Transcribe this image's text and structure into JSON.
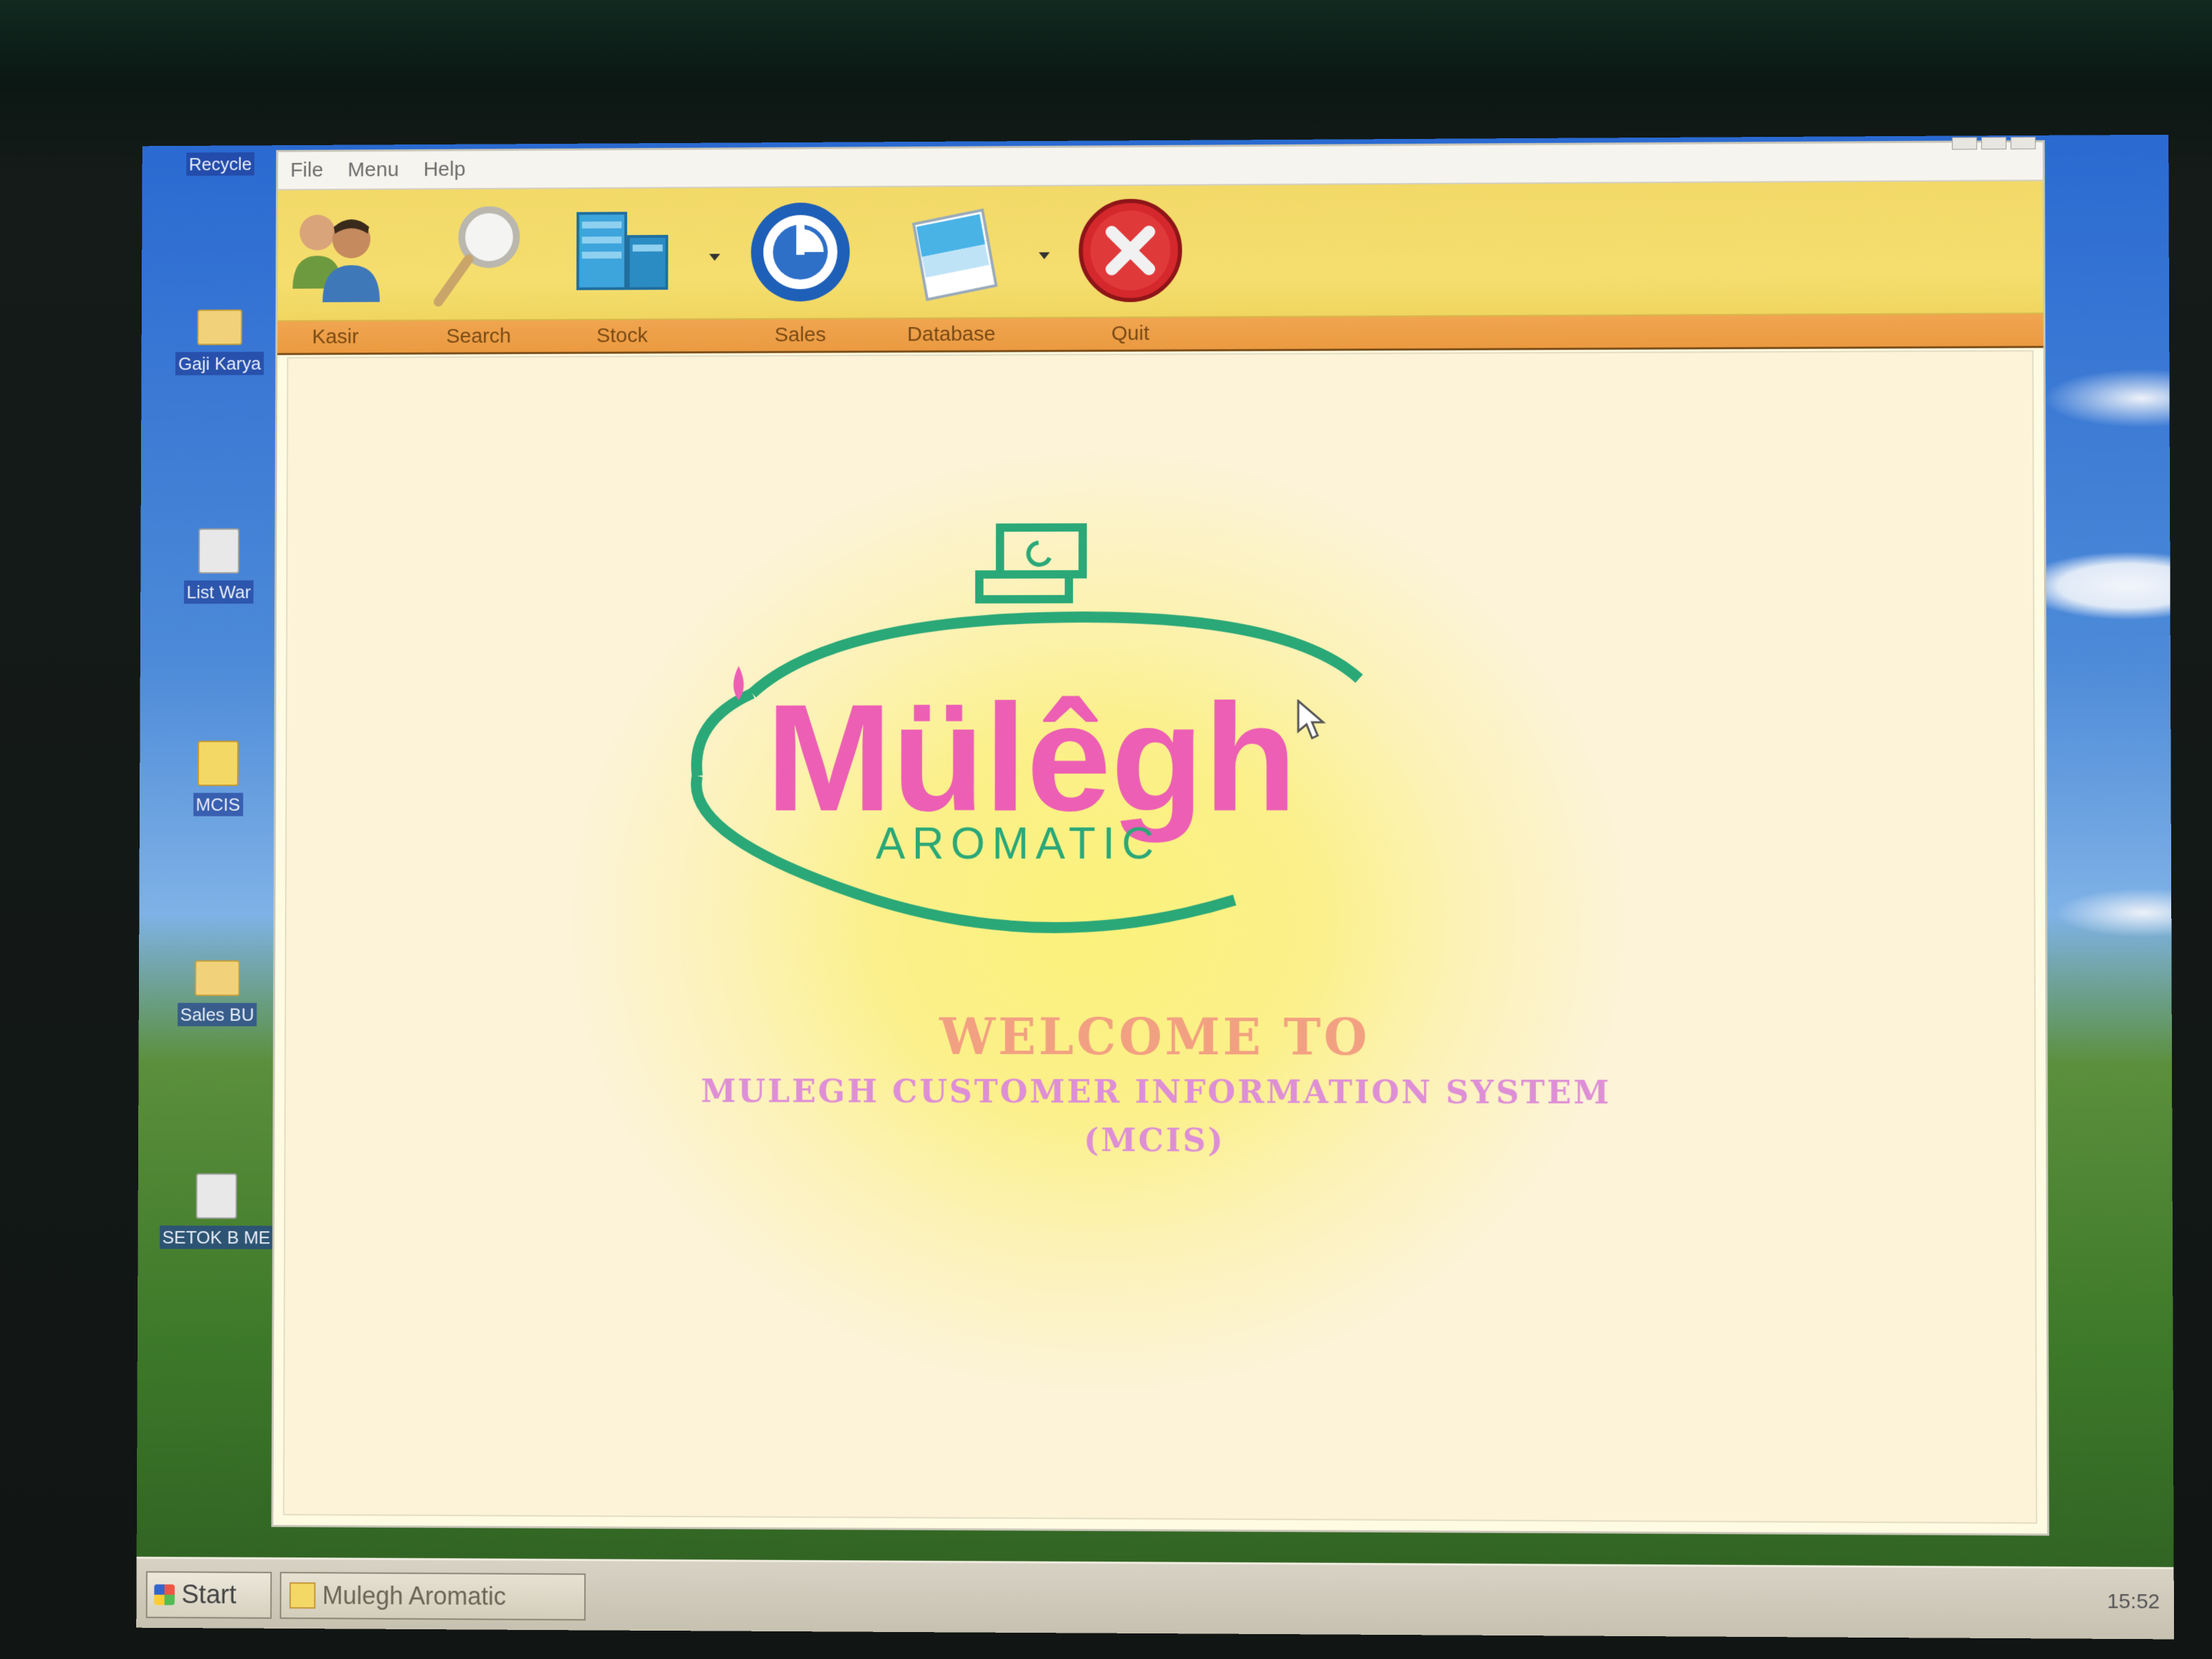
{
  "desktop": {
    "icons": [
      {
        "label": "Recycle"
      },
      {
        "label": "Gaji Karya"
      },
      {
        "label": "List War"
      },
      {
        "label": "MCIS"
      },
      {
        "label": "Sales BU"
      },
      {
        "label": "SETOK B ME"
      }
    ]
  },
  "menubar": {
    "items": [
      "File",
      "Menu",
      "Help"
    ]
  },
  "toolbar": {
    "buttons": [
      {
        "label": "Kasir",
        "icon": "users-icon"
      },
      {
        "label": "Search",
        "icon": "magnifier-icon"
      },
      {
        "label": "Stock",
        "icon": "server-stack-icon"
      },
      {
        "label": "Sales",
        "icon": "dial-clock-icon"
      },
      {
        "label": "Database",
        "icon": "notepad-icon"
      },
      {
        "label": "Quit",
        "icon": "close-icon"
      }
    ]
  },
  "logo": {
    "brand": "Mülêgh",
    "tagline": "AROMATIC"
  },
  "welcome": {
    "line1": "WELCOME TO",
    "line2": "MULEGH CUSTOMER INFORMATION SYSTEM",
    "line3": "(MCIS)"
  },
  "taskbar": {
    "start": "Start",
    "task": "Mulegh Aromatic",
    "clock": "15:52"
  },
  "colors": {
    "toolbar_bg": "#f2d968",
    "labelbar_bg": "#eb9a40",
    "brand_pink": "#ec5fb4",
    "brand_green": "#2aa878",
    "welcome": "#f2a082",
    "system_name": "#de8fd6"
  }
}
